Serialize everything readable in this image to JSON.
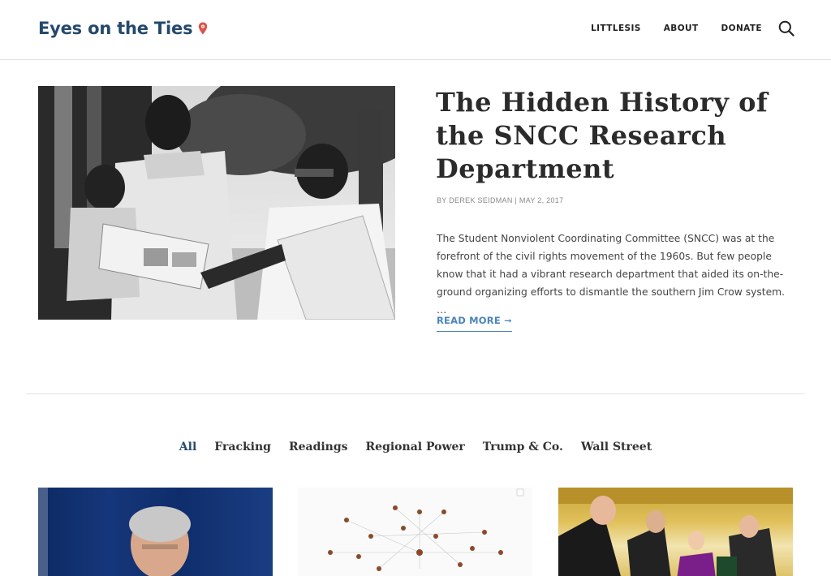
{
  "header": {
    "logo_text": "Eyes on the Ties",
    "nav": [
      {
        "label": "LITTLESIS"
      },
      {
        "label": "ABOUT"
      },
      {
        "label": "DONATE"
      }
    ]
  },
  "featured": {
    "title": "The Hidden History of the SNCC Research Department",
    "byline": "BY DEREK SEIDMAN | MAY 2, 2017",
    "excerpt": "The Student Nonviolent Coordinating Committee (SNCC) was at the forefront of the civil rights movement of the 1960s. But few people know that it had a vibrant research department that aided its on-the-ground organizing efforts to dismantle the southern Jim Crow system. …",
    "read_more": "READ MORE ➞"
  },
  "filters": [
    {
      "label": "All"
    },
    {
      "label": "Fracking"
    },
    {
      "label": "Readings"
    },
    {
      "label": "Regional Power"
    },
    {
      "label": "Trump & Co."
    },
    {
      "label": "Wall Street"
    }
  ],
  "colors": {
    "brand": "#25496d",
    "link": "#4a84bb",
    "pin": "#d9534f"
  }
}
